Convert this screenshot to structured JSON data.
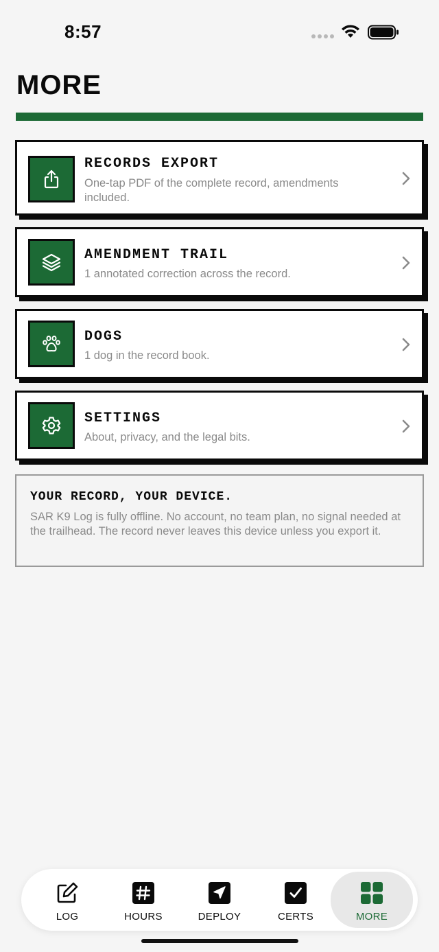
{
  "status_bar": {
    "time": "8:57"
  },
  "header": {
    "title": "MORE"
  },
  "menu": [
    {
      "title": "RECORDS EXPORT",
      "description": "One-tap PDF of the complete record, amendments included.",
      "icon": "share-export-icon"
    },
    {
      "title": "AMENDMENT TRAIL",
      "description": "1 annotated correction across the record.",
      "icon": "layers-icon"
    },
    {
      "title": "DOGS",
      "description": "1 dog in the record book.",
      "icon": "paw-icon"
    },
    {
      "title": "SETTINGS",
      "description": "About, privacy, and the legal bits.",
      "icon": "gear-icon"
    }
  ],
  "info": {
    "title": "YOUR RECORD, YOUR DEVICE.",
    "text": "SAR K9 Log is fully offline. No account, no team plan, no signal needed at the trailhead. The record never leaves this device unless you export it."
  },
  "tabs": [
    {
      "label": "LOG",
      "icon": "edit-icon",
      "active": false
    },
    {
      "label": "HOURS",
      "icon": "hash-icon",
      "active": false
    },
    {
      "label": "DEPLOY",
      "icon": "navigation-icon",
      "active": false
    },
    {
      "label": "CERTS",
      "icon": "check-square-icon",
      "active": false
    },
    {
      "label": "MORE",
      "icon": "grid-icon",
      "active": true
    }
  ],
  "colors": {
    "accent": "#1c6a35",
    "ink": "#0a0a0a",
    "muted": "#8a8a8a",
    "background": "#f5f5f5"
  }
}
